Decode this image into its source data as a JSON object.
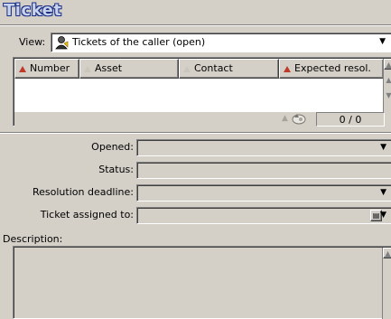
{
  "window": {
    "title": "Ticket"
  },
  "view": {
    "label": "View:",
    "selected": "Tickets of the caller (open)"
  },
  "grid": {
    "columns": [
      "Number",
      "Asset",
      "Contact",
      "Expected resol."
    ],
    "rows": [],
    "counter": "0 / 0"
  },
  "form": {
    "opened": {
      "label": "Opened:",
      "value": ""
    },
    "status": {
      "label": "Status:",
      "value": ""
    },
    "resolution_deadline": {
      "label": "Resolution deadline:",
      "value": ""
    },
    "assigned_to": {
      "label": "Ticket assigned to:",
      "value": ""
    }
  },
  "description": {
    "label": "Description:",
    "value": ""
  },
  "colors": {
    "title_text": "#c9d3ec",
    "title_outline": "#1b2f86",
    "mandatory_marker": "#c0392b",
    "panel_bg": "#d4d0c8"
  },
  "icons": {
    "view": "user-icon",
    "scroll_up": "triangle-up-icon",
    "scroll_down": "triangle-down-icon",
    "refresh": "refresh-icon"
  }
}
